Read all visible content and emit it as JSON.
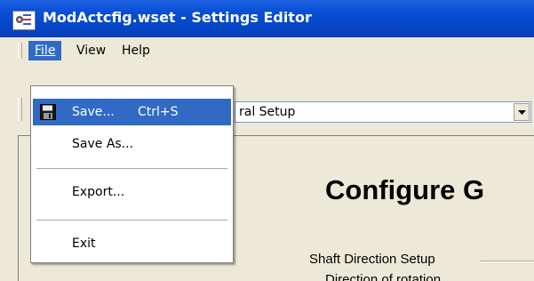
{
  "window": {
    "title": "ModActcfig.wset - Settings Editor",
    "title_bar_color": "#0a4fd6",
    "icon": "app-settings-icon"
  },
  "menubar": {
    "items": [
      {
        "label": "File",
        "access_key": "F",
        "open": true
      },
      {
        "label": "View",
        "access_key": "V"
      },
      {
        "label": "Help",
        "access_key": "H"
      }
    ]
  },
  "file_menu": {
    "highlight_color": "#316ac5",
    "items": [
      {
        "label": "Save...",
        "access_key": "S",
        "shortcut": "Ctrl+S",
        "icon": "floppy-disk-icon",
        "highlighted": true
      },
      {
        "label": "Save As...",
        "access_key": "A"
      },
      {
        "label": "Export...",
        "access_key": "E"
      },
      {
        "label": "Exit",
        "access_key": "x"
      }
    ]
  },
  "toolbar": {
    "combo": {
      "selected_value_visible": "ral Setup"
    }
  },
  "main": {
    "heading_visible": "Configure G",
    "section_label": "Shaft Direction Setup",
    "sub_label_visible": "Direction of rotation"
  }
}
